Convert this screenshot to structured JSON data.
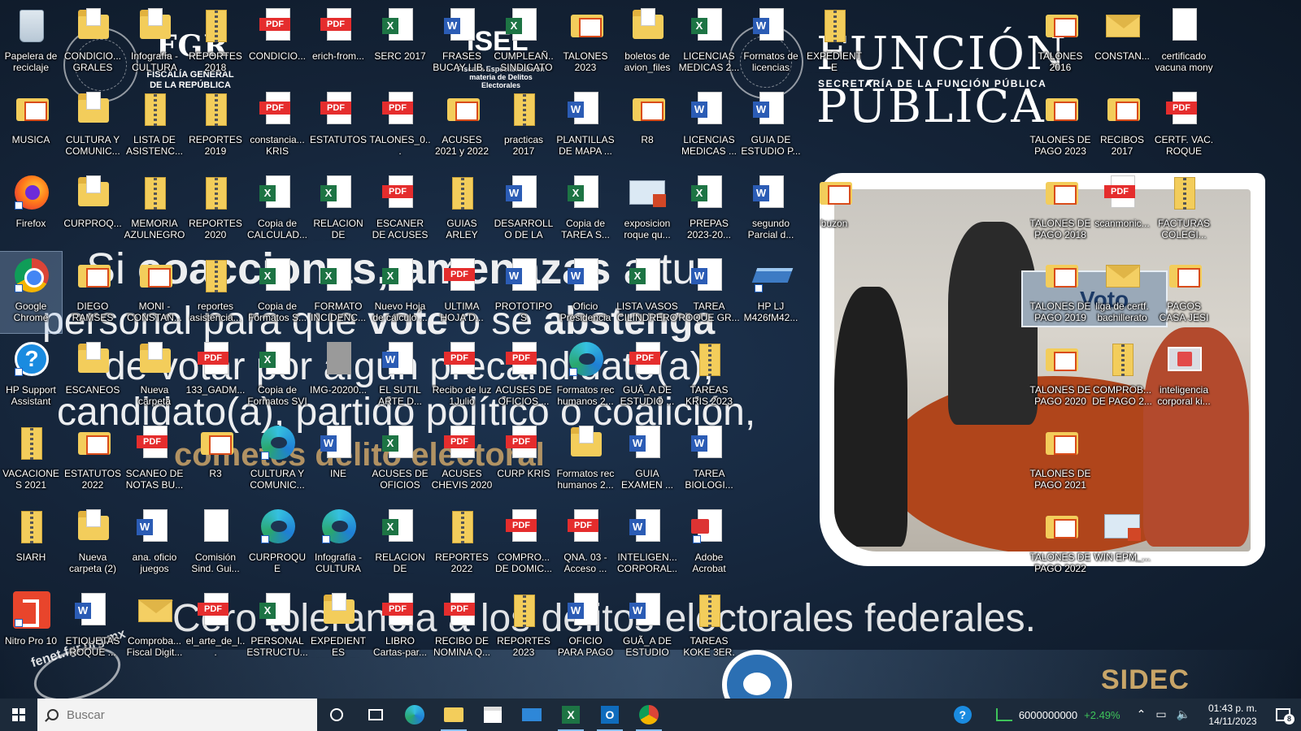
{
  "wallpaper": {
    "fgr_title": "FGR",
    "fgr_subtitle": "FISCALÍA GENERAL DE LA REPÚBLICA",
    "isel_title": "ISEL",
    "isel_subtitle": "Fiscalía Especializada en materia de Delitos Electorales",
    "fp_title": "FUNCIÓN PÚBLICA",
    "fp_subtitle": "SECRETARÍA DE LA FUNCIÓN PÚBLICA",
    "slogan_1a": "Si ",
    "slogan_1b": "coaccionas, amenazas",
    "slogan_1c": " a tu",
    "slogan_2a": "personal para que ",
    "slogan_2b": "vote",
    "slogan_2c": " o se ",
    "slogan_2d": "abstenga",
    "slogan_3": "de votar por algún precandidato(a),",
    "slogan_4": "candidato(a), partido político o coalición,",
    "slogan_5": "cometes delito electoral",
    "slogan_6": "Cero tolerancia a los delitos electorales federales.",
    "badge_text": "fenet.fgr.org.mx",
    "sidec_text": "SIDEC",
    "photo_sign": "Voto",
    "colors": {
      "accent_red": "#e52d2d",
      "excel_green": "#1d7444",
      "word_blue": "#2b5cb5",
      "folder_yellow": "#f3cd5b"
    }
  },
  "desktop_icons": [
    {
      "label": "Papelera de reciclaje",
      "icon": "recycle-bin-icon",
      "kind": "recycle"
    },
    {
      "label": "CONDICIO... GRALES TRAB...",
      "icon": "folder-icon",
      "kind": "folder"
    },
    {
      "label": "Infografía - CULTURA O...",
      "icon": "folder-icon",
      "kind": "folder"
    },
    {
      "label": "REPORTES 2018",
      "icon": "zip-folder-icon",
      "kind": "zip"
    },
    {
      "label": "CONDICIO...",
      "icon": "pdf-icon",
      "kind": "pdf"
    },
    {
      "label": "erich-from...",
      "icon": "pdf-icon",
      "kind": "pdf"
    },
    {
      "label": "SERC 2017",
      "icon": "excel-icon",
      "kind": "excel"
    },
    {
      "label": "FRASES BUCAY LIB...",
      "icon": "word-icon",
      "kind": "word"
    },
    {
      "label": "CUMPLEAÑ... SINDICATO ...",
      "icon": "excel-icon",
      "kind": "excel"
    },
    {
      "label": "TALONES 2023",
      "icon": "folder-icon",
      "kind": "dat"
    },
    {
      "label": "boletos de avion_files",
      "icon": "folder-icon",
      "kind": "folder"
    },
    {
      "label": "LICENCIAS MEDICAS 2...",
      "icon": "excel-icon",
      "kind": "excel"
    },
    {
      "label": "Formatos de licencias",
      "icon": "word-icon",
      "kind": "word"
    },
    {
      "label": "EXPEDIENTE ELECTRON...",
      "icon": "zip-folder-icon",
      "kind": "zip"
    },
    {
      "label": "TALONES 2016",
      "icon": "folder-icon",
      "kind": "dat"
    },
    {
      "label": "CONSTAN...",
      "icon": "mail-icon",
      "kind": "mail"
    },
    {
      "label": "certificado vacuna mony",
      "icon": "document-icon",
      "kind": "page"
    },
    {
      "label": "MUSICA",
      "icon": "folder-icon",
      "kind": "dat"
    },
    {
      "label": "CULTURA Y COMUNIC...",
      "icon": "folder-icon",
      "kind": "folder"
    },
    {
      "label": "LISTA DE ASISTENC...",
      "icon": "zip-folder-icon",
      "kind": "zip"
    },
    {
      "label": "REPORTES 2019",
      "icon": "zip-folder-icon",
      "kind": "zip"
    },
    {
      "label": "constancia... KRIS",
      "icon": "pdf-icon",
      "kind": "pdf"
    },
    {
      "label": "ESTATUTOS",
      "icon": "pdf-icon",
      "kind": "pdf"
    },
    {
      "label": "TALONES_0...",
      "icon": "pdf-icon",
      "kind": "pdf"
    },
    {
      "label": "ACUSES 2021 y 2022",
      "icon": "folder-icon",
      "kind": "dat"
    },
    {
      "label": "practicas 2017",
      "icon": "zip-folder-icon",
      "kind": "zip"
    },
    {
      "label": "PLANTILLAS DE MAPA ...",
      "icon": "word-icon",
      "kind": "word"
    },
    {
      "label": "R8",
      "icon": "folder-icon",
      "kind": "dat"
    },
    {
      "label": "LICENCIAS MEDICAS ...",
      "icon": "word-icon",
      "kind": "word"
    },
    {
      "label": "GUIA DE ESTUDIO P...",
      "icon": "word-icon",
      "kind": "word"
    },
    {
      "label": "TALONES DE PAGO 2023",
      "icon": "folder-icon",
      "kind": "dat"
    },
    {
      "label": "RECIBOS 2017",
      "icon": "folder-icon",
      "kind": "dat"
    },
    {
      "label": "CERTF. VAC. ROQUE",
      "icon": "pdf-icon",
      "kind": "pdf"
    },
    {
      "label": "Firefox",
      "icon": "firefox-icon",
      "kind": "firefox"
    },
    {
      "label": "CURPROQ...",
      "icon": "folder-icon",
      "kind": "folder"
    },
    {
      "label": "MEMORIA AZULNEGRO",
      "icon": "zip-folder-icon",
      "kind": "zip"
    },
    {
      "label": "REPORTES 2020",
      "icon": "zip-folder-icon",
      "kind": "zip"
    },
    {
      "label": "Copia de CALCULAD...",
      "icon": "excel-icon",
      "kind": "excel"
    },
    {
      "label": "RELACION DE ENTREG...",
      "icon": "excel-icon",
      "kind": "excel"
    },
    {
      "label": "ESCANER DE ACUSES D...",
      "icon": "pdf-icon",
      "kind": "pdf"
    },
    {
      "label": "GUIAS ARLEY",
      "icon": "zip-folder-icon",
      "kind": "zip"
    },
    {
      "label": "DESARROLLO DE LA MAT...",
      "icon": "word-icon",
      "kind": "word"
    },
    {
      "label": "Copia de TAREA S...",
      "icon": "excel-icon",
      "kind": "excel"
    },
    {
      "label": "exposicion roque qu...",
      "icon": "powerpoint-icon",
      "kind": "ppt"
    },
    {
      "label": "PREPAS 2023-20...",
      "icon": "excel-icon",
      "kind": "excel"
    },
    {
      "label": "segundo Parcial d...",
      "icon": "word-icon",
      "kind": "word"
    },
    {
      "label": "buzon",
      "icon": "folder-icon",
      "kind": "dat"
    },
    {
      "label": "TALONES DE PAGO 2018",
      "icon": "folder-icon",
      "kind": "dat"
    },
    {
      "label": "scanmonic...",
      "icon": "pdf-icon",
      "kind": "pdf"
    },
    {
      "label": "FACTURAS COLEGI...",
      "icon": "zip-folder-icon",
      "kind": "zip"
    },
    {
      "label": "Google Chrome",
      "icon": "chrome-icon",
      "kind": "chrome",
      "selected": true
    },
    {
      "label": "DIEGO RAMSES",
      "icon": "folder-icon",
      "kind": "dat"
    },
    {
      "label": "MONI - CONSTAN...",
      "icon": "pdf-folder-icon",
      "kind": "dat"
    },
    {
      "label": "reportes asistencia...",
      "icon": "zip-folder-icon",
      "kind": "zip"
    },
    {
      "label": "Copia de Formatos S...",
      "icon": "excel-icon",
      "kind": "excel"
    },
    {
      "label": "FORMATO INCIDENC...",
      "icon": "excel-icon",
      "kind": "excel"
    },
    {
      "label": "Nuevo Hoja de cálculo ...",
      "icon": "excel-icon",
      "kind": "excel"
    },
    {
      "label": "ULTIMA HOJA D...",
      "icon": "pdf-icon",
      "kind": "pdf"
    },
    {
      "label": "PROTOTIPOS TEXTUALES",
      "icon": "word-icon",
      "kind": "word"
    },
    {
      "label": "Oficio Presidencia",
      "icon": "word-icon",
      "kind": "word"
    },
    {
      "label": "LISTA VASOS CILINDREROS",
      "icon": "excel-icon",
      "kind": "excel"
    },
    {
      "label": "TAREA ROQUE GR...",
      "icon": "word-icon",
      "kind": "word"
    },
    {
      "label": "HP LJ M426fM42...",
      "icon": "scanner-icon",
      "kind": "scanner"
    },
    {
      "label": "TALONES DE PAGO 2019",
      "icon": "folder-icon",
      "kind": "dat"
    },
    {
      "label": "liga de certf. bachillerato",
      "icon": "mail-icon",
      "kind": "mail"
    },
    {
      "label": "PAGOS CASA JESI",
      "icon": "folder-icon",
      "kind": "dat"
    },
    {
      "label": "HP Support Assistant",
      "icon": "help-icon",
      "kind": "help"
    },
    {
      "label": "ESCANEOS",
      "icon": "folder-icon",
      "kind": "folder"
    },
    {
      "label": "Nueva carpeta",
      "icon": "folder-icon",
      "kind": "folder"
    },
    {
      "label": "133_GADM...",
      "icon": "pdf-icon",
      "kind": "pdf"
    },
    {
      "label": "Copia de Formatos SVI",
      "icon": "excel-icon",
      "kind": "excel"
    },
    {
      "label": "IMG-20200...",
      "icon": "image-icon",
      "kind": "img"
    },
    {
      "label": "EL SUTIL ARTE D...",
      "icon": "word-icon",
      "kind": "word"
    },
    {
      "label": "Recibo de luz 1Julio",
      "icon": "pdf-icon",
      "kind": "pdf"
    },
    {
      "label": "ACUSES DE OFICIOS ...",
      "icon": "pdf-icon",
      "kind": "pdf"
    },
    {
      "label": "Formatos rec humanos 2...",
      "icon": "edge-icon",
      "kind": "edge"
    },
    {
      "label": "GUÃ_A DE ESTUDIO ...",
      "icon": "pdf-icon",
      "kind": "pdf"
    },
    {
      "label": "TAREAS KRIS 2023",
      "icon": "zip-folder-icon",
      "kind": "zip"
    },
    {
      "label": "TALONES DE PAGO 2020",
      "icon": "folder-icon",
      "kind": "dat"
    },
    {
      "label": "COMPROB... DE PAGO 2...",
      "icon": "zip-folder-icon",
      "kind": "zip"
    },
    {
      "label": "inteligencia corporal ki...",
      "icon": "photo-icon",
      "kind": "photo"
    },
    {
      "label": "VACACIONES 2021",
      "icon": "zip-folder-icon",
      "kind": "zip"
    },
    {
      "label": "ESTATUTOS 2022",
      "icon": "folder-icon",
      "kind": "dat"
    },
    {
      "label": "SCANEO DE NOTAS BU...",
      "icon": "pdf-icon",
      "kind": "pdf"
    },
    {
      "label": "R3",
      "icon": "folder-icon",
      "kind": "dat"
    },
    {
      "label": "CULTURA Y COMUNIC...",
      "icon": "edge-icon",
      "kind": "edge"
    },
    {
      "label": "INE",
      "icon": "word-icon",
      "kind": "word"
    },
    {
      "label": "ACUSES DE OFICIOS PE...",
      "icon": "excel-icon",
      "kind": "excel"
    },
    {
      "label": "ACUSES CHEVIS 2020",
      "icon": "pdf-icon",
      "kind": "pdf"
    },
    {
      "label": "CURP KRIS",
      "icon": "pdf-icon",
      "kind": "pdf"
    },
    {
      "label": "Formatos rec humanos 2...",
      "icon": "folder-icon",
      "kind": "folder"
    },
    {
      "label": "GUIA EXAMEN ...",
      "icon": "word-icon",
      "kind": "word"
    },
    {
      "label": "TAREA BIOLOGI...",
      "icon": "word-icon",
      "kind": "word"
    },
    {
      "label": "TALONES DE PAGO 2021",
      "icon": "folder-icon",
      "kind": "dat"
    },
    {
      "label": "SIARH",
      "icon": "zip-folder-icon",
      "kind": "zip"
    },
    {
      "label": "Nueva carpeta (2)",
      "icon": "folder-icon",
      "kind": "folder"
    },
    {
      "label": "ana. oficio juegos",
      "icon": "word-icon",
      "kind": "word"
    },
    {
      "label": "Comisión Sind. Gui...",
      "icon": "document-icon",
      "kind": "page"
    },
    {
      "label": "CURPROQUE",
      "icon": "edge-icon",
      "kind": "edge"
    },
    {
      "label": "Infografía - CULTURA O...",
      "icon": "edge-icon",
      "kind": "edge"
    },
    {
      "label": "RELACION DE ENTREG...",
      "icon": "excel-icon",
      "kind": "excel"
    },
    {
      "label": "REPORTES 2022",
      "icon": "zip-folder-icon",
      "kind": "zip"
    },
    {
      "label": "COMPRO... DE DOMIC...",
      "icon": "pdf-icon",
      "kind": "pdf"
    },
    {
      "label": "QNA. 03 - Acceso ...",
      "icon": "pdf-icon",
      "kind": "pdf"
    },
    {
      "label": "INTELIGEN... CORPORAL...",
      "icon": "word-icon",
      "kind": "word"
    },
    {
      "label": "Adobe Acrobat",
      "icon": "acrobat-icon",
      "kind": "acrobat"
    },
    {
      "label": "TALONES DE PAGO 2022",
      "icon": "folder-icon",
      "kind": "dat"
    },
    {
      "label": "WIN EPM_...",
      "icon": "powerpoint-icon",
      "kind": "ppt"
    },
    {
      "label": "Nitro Pro 10",
      "icon": "nitro-icon",
      "kind": "nitro"
    },
    {
      "label": "ETIQUETAS ROQUE ...",
      "icon": "word-icon",
      "kind": "word"
    },
    {
      "label": "Comproba... Fiscal Digit...",
      "icon": "mail-icon",
      "kind": "mail"
    },
    {
      "label": "el_arte_de_l...",
      "icon": "pdf-icon",
      "kind": "pdf"
    },
    {
      "label": "PERSONAL ESTRUCTU...",
      "icon": "excel-icon",
      "kind": "excel"
    },
    {
      "label": "EXPEDIENTES HONORARI...",
      "icon": "folder-icon",
      "kind": "folder"
    },
    {
      "label": "LIBRO Cartas-par...",
      "icon": "pdf-icon",
      "kind": "pdf"
    },
    {
      "label": "RECIBO DE NOMINA Q...",
      "icon": "pdf-icon",
      "kind": "pdf"
    },
    {
      "label": "REPORTES 2023",
      "icon": "zip-folder-icon",
      "kind": "zip"
    },
    {
      "label": "OFICIO PARA PAGO DE C...",
      "icon": "word-icon",
      "kind": "word"
    },
    {
      "label": "GUÃ_A DE ESTUDIO EX...",
      "icon": "word-icon",
      "kind": "word"
    },
    {
      "label": "TAREAS KOKE 3ER. SEMES...",
      "icon": "zip-folder-icon",
      "kind": "zip"
    }
  ],
  "taskbar": {
    "search_placeholder": "Buscar",
    "apps": [
      "cortana-icon",
      "task-view-icon",
      "edge-icon",
      "file-explorer-icon",
      "store-icon",
      "mail-icon",
      "excel-icon",
      "outlook-icon",
      "chrome-icon"
    ],
    "stock_value": "6000000000",
    "stock_change": "+2.49%",
    "clock_time": "01:43 p. m.",
    "clock_date": "14/11/2023",
    "notification_count": "8"
  }
}
